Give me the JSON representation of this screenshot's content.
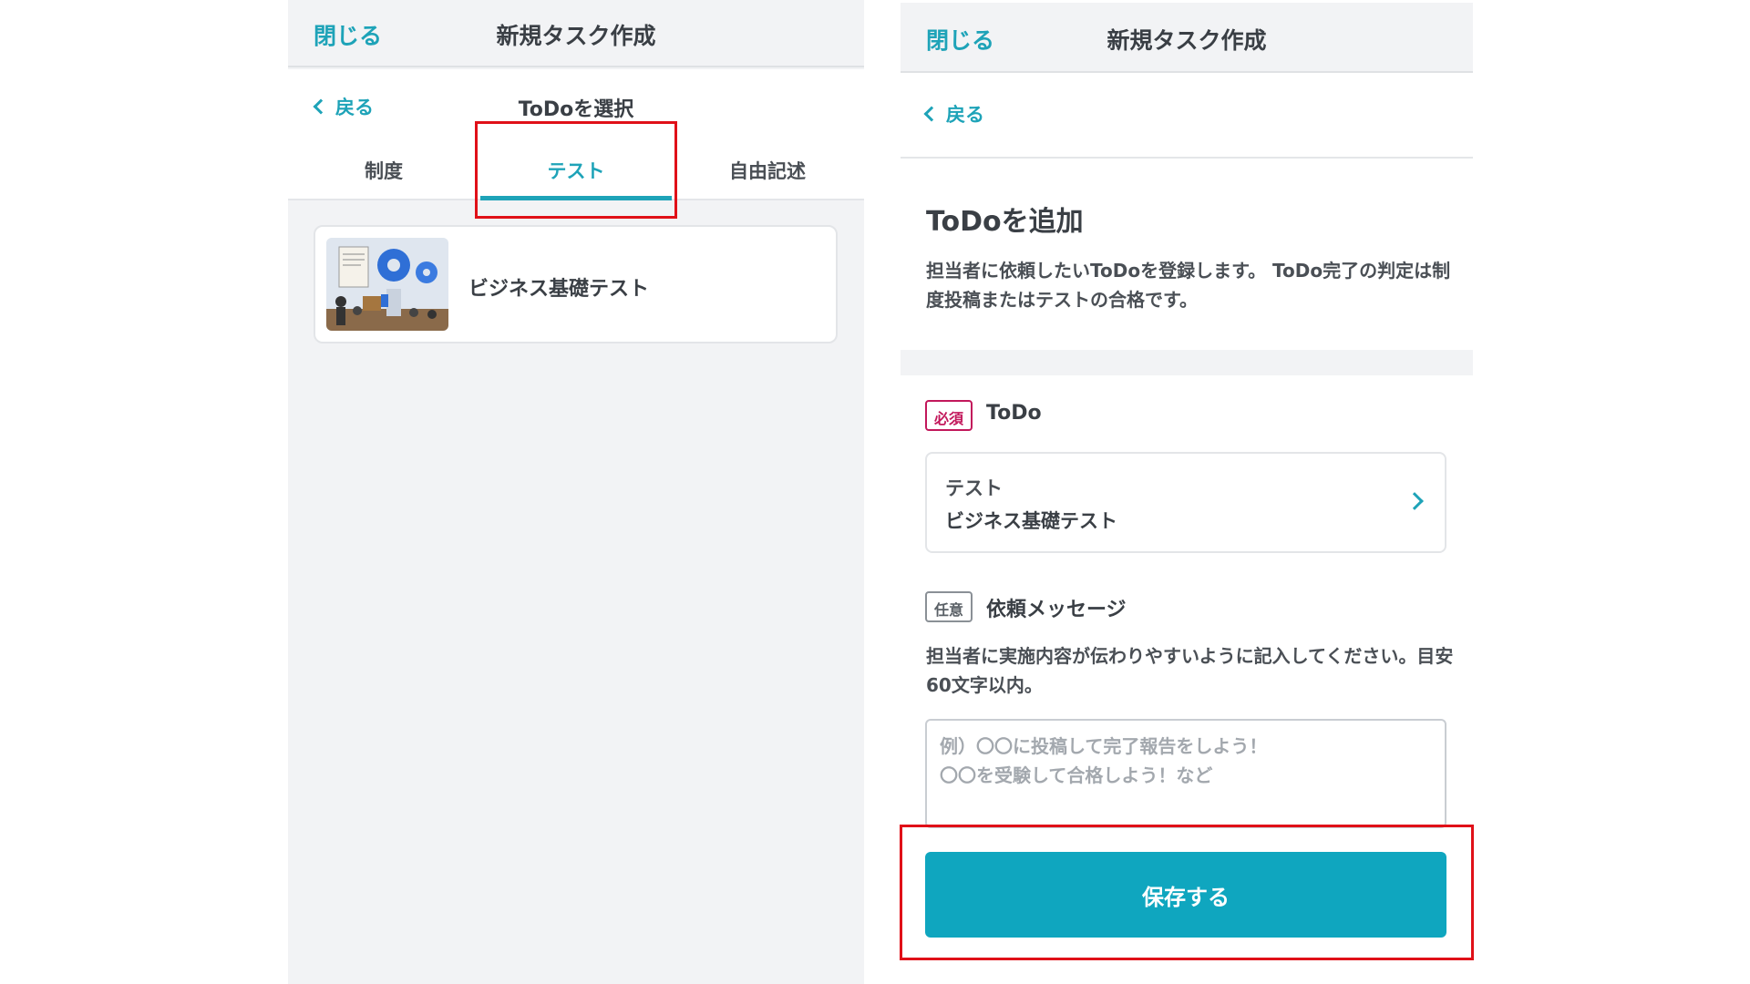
{
  "left": {
    "header": {
      "close_label": "閉じる",
      "title": "新規タスク作成"
    },
    "nav": {
      "back_label": "戻る",
      "title": "ToDoを選択"
    },
    "tabs": [
      {
        "label": "制度"
      },
      {
        "label": "テスト",
        "active": true
      },
      {
        "label": "自由記述"
      }
    ],
    "items": [
      {
        "title": "ビジネス基礎テスト",
        "thumbnail": "business-gears-illustration"
      }
    ]
  },
  "right": {
    "header": {
      "close_label": "閉じる",
      "title": "新規タスク作成"
    },
    "back_label": "戻る",
    "intro": {
      "title": "ToDoを追加",
      "description": "担当者に依頼したいToDoを登録します。 ToDo完了の判定は制度投稿またはテストの合格です。"
    },
    "todo_field": {
      "badge": "必須",
      "label": "ToDo",
      "selected_category": "テスト",
      "selected_name": "ビジネス基礎テスト"
    },
    "message_field": {
      "badge": "任意",
      "label": "依頼メッセージ",
      "help": "担当者に実施内容が伝わりやすいように記入してください。目安60文字以内。",
      "placeholder": "例）〇〇に投稿して完了報告をしよう！\n〇〇を受験して合格しよう！など",
      "value": ""
    },
    "save_label": "保存する"
  },
  "colors": {
    "accent": "#1ea3b8",
    "button": "#0fa6bf",
    "required": "#c2185b",
    "highlight": "#e01018",
    "panel_bg": "#f2f3f5"
  }
}
